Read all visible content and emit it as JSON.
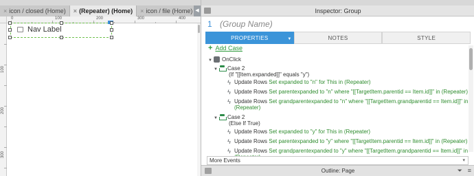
{
  "editor": {
    "tabs": [
      {
        "label": "icon / closed (Home)",
        "close": "×",
        "active": false
      },
      {
        "label": "(Repeater) (Home)",
        "close": "×",
        "active": true
      },
      {
        "label": "icon / file (Home)",
        "close": "×",
        "active": false
      }
    ],
    "tab_scroll_glyph": "◀",
    "hruler_labels": [
      "0",
      "100",
      "200",
      "300",
      "400"
    ],
    "vruler_labels": [
      "100",
      "200",
      "300"
    ],
    "widget": {
      "label": "Nav Label",
      "icon": "folder-icon"
    }
  },
  "inspector": {
    "title": "Inspector: Group",
    "item_number": "1",
    "item_name": "(Group Name)",
    "tabs": [
      {
        "label": "PROPERTIES",
        "active": true
      },
      {
        "label": "NOTES",
        "active": false
      },
      {
        "label": "STYLE",
        "active": false
      }
    ],
    "add_case": "Add Case",
    "event": {
      "name": "OnClick"
    },
    "cases": [
      {
        "name": "Case 2",
        "condition": "(If \"[[Item.expanded]]\" equals \"y\")",
        "actions": [
          {
            "name": "Update Rows",
            "desc": "Set expanded to \"n\" for This in (Repeater)"
          },
          {
            "name": "Update Rows",
            "desc": "Set parentexpanded to \"n\" where \"[[TargetItem.parentid == Item.id]]\" in (Repeater)"
          },
          {
            "name": "Update Rows",
            "desc": "Set grandparentexpanded to \"n\" where \"[[TargetItem.grandparentid == Item.id]]\" in",
            "desc2": "(Repeater)"
          }
        ]
      },
      {
        "name": "Case 2",
        "condition": "(Else If True)",
        "actions": [
          {
            "name": "Update Rows",
            "desc": "Set expanded to \"y\" for This in (Repeater)"
          },
          {
            "name": "Update Rows",
            "desc": "Set parentexpanded to \"y\" where \"[[TargetItem.parentid == Item.id]]\" in (Repeater)"
          },
          {
            "name": "Update Rows",
            "desc": "Set grandparentexpanded to \"y\" where \"[[TargetItem.grandparentid == Item.id]]\" in",
            "desc2": "(Repeater)"
          }
        ]
      }
    ],
    "more_events": "More Events",
    "outline_title": "Outline: Page"
  },
  "colors": {
    "accent": "#3b94d9",
    "action_green": "#2e8c2e",
    "selection_green": "#6fc24e"
  }
}
